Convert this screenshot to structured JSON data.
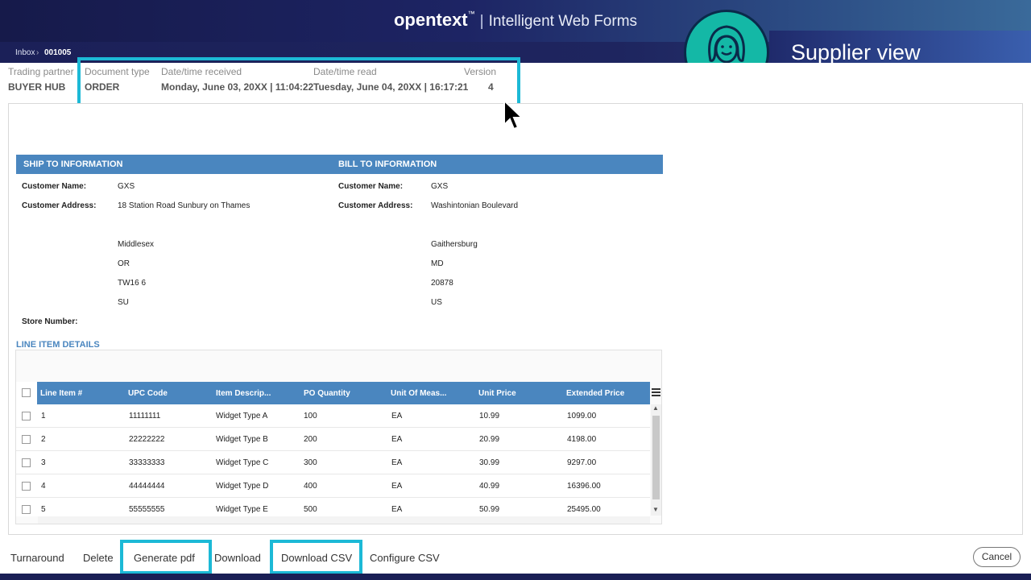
{
  "header": {
    "logo": "opentext",
    "trademark": "™",
    "product": "Intelligent Web Forms"
  },
  "breadcrumb": {
    "inbox": "Inbox",
    "separator": "›",
    "document": "001005"
  },
  "overlay": {
    "supplier_view": "Supplier view",
    "avatar_icon": "woman-avatar-icon"
  },
  "meta": {
    "trading_partner_label": "Trading partner",
    "trading_partner": "BUYER HUB",
    "doc_type_label": "Document type",
    "doc_type": "ORDER",
    "received_label": "Date/time received",
    "received": "Monday, June 03, 20XX | 11:04:22",
    "read_label": "Date/time read",
    "read": "Tuesday, June 04, 20XX | 16:17:21",
    "version_label": "Version",
    "version": "4"
  },
  "ship_to": {
    "title": "SHIP TO INFORMATION",
    "name_label": "Customer Name:",
    "name": "GXS",
    "address_label": "Customer Address:",
    "address": "18 Station Road Sunbury on Thames",
    "line1": "Middlesex",
    "line2": "OR",
    "line3": "TW16 6",
    "line4": "SU",
    "store_label": "Store Number:"
  },
  "bill_to": {
    "title": "BILL TO INFORMATION",
    "name_label": "Customer Name:",
    "name": "GXS",
    "address_label": "Customer Address:",
    "address": "Washintonian Boulevard",
    "line1": "Gaithersburg",
    "line2": "MD",
    "line3": "20878",
    "line4": "US"
  },
  "line_items": {
    "title": "LINE ITEM DETAILS",
    "columns": [
      "Line Item #",
      "UPC Code",
      "Item Descrip...",
      "PO Quantity",
      "Unit Of Meas...",
      "Unit Price",
      "Extended Price"
    ],
    "rows": [
      [
        "1",
        "11111111",
        "Widget Type A",
        "100",
        "EA",
        "10.99",
        "1099.00"
      ],
      [
        "2",
        "22222222",
        "Widget Type B",
        "200",
        "EA",
        "20.99",
        "4198.00"
      ],
      [
        "3",
        "33333333",
        "Widget Type C",
        "300",
        "EA",
        "30.99",
        "9297.00"
      ],
      [
        "4",
        "44444444",
        "Widget Type D",
        "400",
        "EA",
        "40.99",
        "16396.00"
      ],
      [
        "5",
        "55555555",
        "Widget Type E",
        "500",
        "EA",
        "50.99",
        "25495.00"
      ]
    ]
  },
  "footer": {
    "turnaround": "Turnaround",
    "delete": "Delete",
    "generate_pdf": "Generate pdf",
    "download": "Download",
    "download_csv": "Download CSV",
    "configure_csv": "Configure CSV",
    "cancel": "Cancel"
  },
  "colors": {
    "highlight": "#1cb9d6",
    "section_blue": "#4a86bf",
    "avatar": "#14b8a6"
  }
}
